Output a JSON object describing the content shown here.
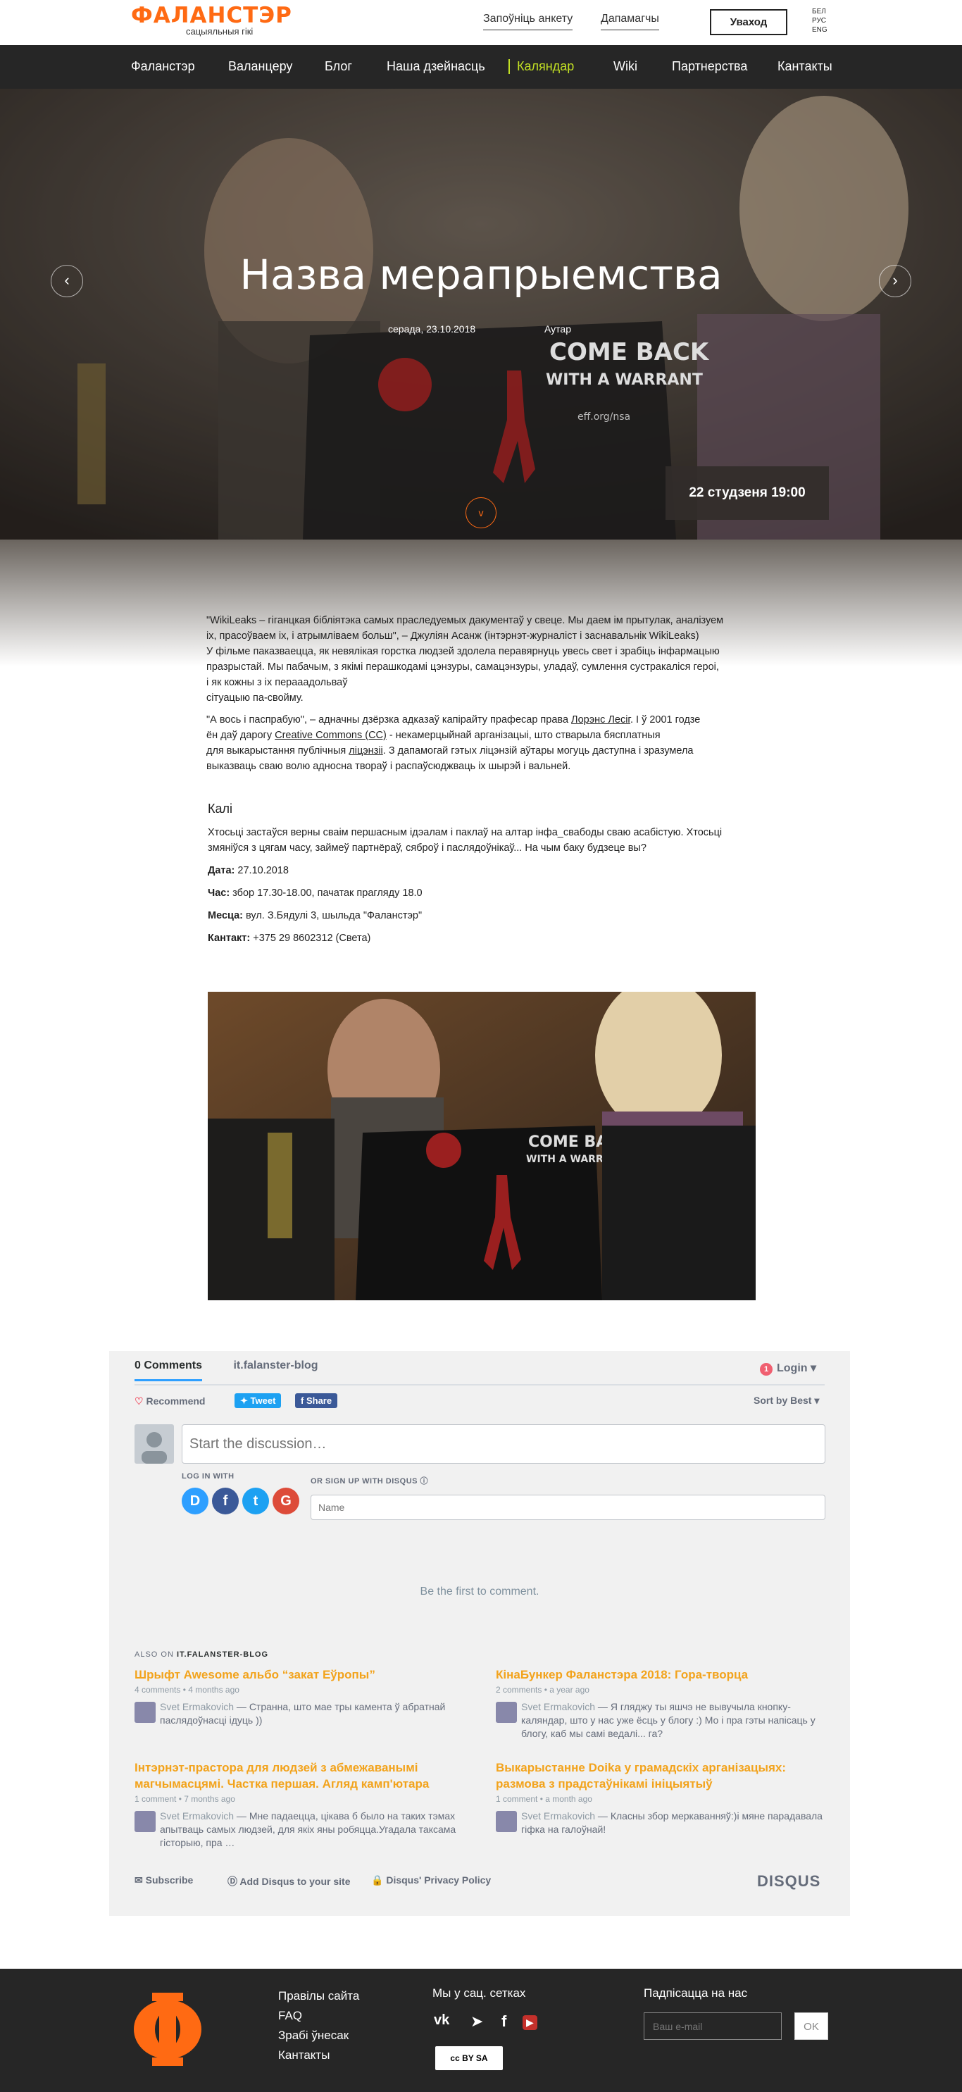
{
  "header": {
    "logo_text": "ФАЛАНСТЭР",
    "logo_tagline": "сацыяльныя гікі",
    "fill_form_link": "Запоўніць анкету",
    "help_link": "Дапамагчы",
    "login_button": "Уваход",
    "languages": [
      "БЕЛ",
      "РУС",
      "ENG"
    ]
  },
  "nav": {
    "items": [
      "Фаланстэр",
      "Валанцеру",
      "Блог",
      "Наша дзейнасць",
      "Каляндар",
      "Wiki",
      "Партнерства",
      "Кантакты"
    ],
    "active": "Каляндар",
    "active_color": "#c2e024"
  },
  "hero": {
    "title": "Назва мерапрыемства",
    "date": "серада, 23.10.2018",
    "author": "Аутар",
    "prev_icon": "‹",
    "next_icon": "›",
    "event_when": "22 студзеня 19:00",
    "scroll_icon": "v",
    "laptop_sticker_line1": "COME BACK",
    "laptop_sticker_line2": "WITH A WARRANT",
    "laptop_sticker_url": "eff.org/nsa"
  },
  "article": {
    "p1_line1": "\"WikiLeaks – гіганцкая бібліятэка самых праследуемых дакументаў у свеце. Мы даем ім прытулак, аналізуем",
    "p1_line2": "іх, прасоўваем іх, і атрымліваем больш\", – Джуліян Асанж (інтэрнэт-журналіст і заснавальнік WikiLeaks)",
    "p1_line3": "У фільме паказваецца, як невялікая горстка людзей здолела перавярнуць увесь свет і зрабіць інфармацыю",
    "p1_line4": "празрыстай. Мы пабачым, з якімі перашкодамі цэнзуры, самацэнзуры, уладаў, сумлення сустракаліся героі,",
    "p1_line5": "і як кожны з іх перааадольваў",
    "p1_line6": "сітуацыю па-свойму.",
    "p2_a": "\"А вось і паспрабую\", – адначны дзёрзка адказаў капірайту прафесар права ",
    "p2_link1": "Лорэнс Лесіг",
    "p2_b": ". І ў 2001 годзе",
    "p2_c": "ён даў дарогу ",
    "p2_link2": "Creative Commons (CC)",
    "p2_d": " - некамерцыйнай арганізацыі, што стварыла бясплатныя",
    "p2_e": "для выкарыстання публічныя ",
    "p2_link3": "ліцэнзіі",
    "p2_f": ". З дапамогай гэтых ліцэнзій аўтары могуць даступна і зразумела",
    "p2_g": "выказваць сваю волю адносна твораў і распаўсюджваць іх шырэй і вальней."
  },
  "event_info": {
    "heading": "Калі",
    "text_line1": "Хтосьці застаўся верны сваім першасным ідэалам і паклаў на алтар інфа_свабоды сваю асабістую. Хтосьці",
    "text_line2": "змяніўся з цягам часу, займеў партнёраў, сяброў і паслядоўнікаў... На чым баку будзеце вы?",
    "date_label": "Дата:",
    "date_value": " 27.10.2018",
    "time_label": "Час:",
    "time_value": " збор 17.30-18.00, пачатак прагляду 18.0",
    "place_label": "Месца:",
    "place_value": " вул. З.Бядулі 3, шыльда \"Фаланстэр\"",
    "contact_label": "Кантакт:",
    "contact_value": " +375 29 8602312  (Света)"
  },
  "disqus": {
    "tab_comments": "0 Comments",
    "tab_forum": "it.falanster-blog",
    "login": "Login",
    "login_badge": "1",
    "recommend": "Recommend",
    "tweet": "Tweet",
    "share": "Share",
    "sort": "Sort by Best",
    "placeholder": "Start the discussion…",
    "log_in_with": "LOG IN WITH",
    "or_sign_up": "OR SIGN UP WITH DISQUS",
    "name_placeholder": "Name",
    "first_comment": "Be the first to comment.",
    "also_on_prefix": "ALSO ON ",
    "also_on_site": "IT.FALANSTER-BLOG",
    "recommendations": [
      {
        "title": "Шрыфт Awesome альбо “закат Еўропы”",
        "meta": "4 comments • 4 months ago",
        "author": "Svet Ermakovich",
        "excerpt": " — Странна, што мае тры камента ў абратнай паслядоўнасці ідуць ))"
      },
      {
        "title": "КінаБункер Фаланстэра 2018: Гора-творца",
        "meta": "2 comments • a year ago",
        "author": "Svet Ermakovich",
        "excerpt": " — Я гляджу ты яшчэ не вывучыла кнопку-каляндар, што у нас уже ёсць у блогу :) Мо і пра гэты напісаць у блогу, каб мы самі ведалі... га?"
      },
      {
        "title": "Інтэрнэт-прастора для людзей з абмежаванымі магчымасцямі. Частка першая. Агляд камп'ютара",
        "meta": "1 comment • 7 months ago",
        "author": "Svet Ermakovich",
        "excerpt": " — Мне падаецца, цікава б было на таких тэмах апытваць самых людзей, для якіх яны робяцца.Угадала таксама гісторыю, пра …"
      },
      {
        "title": "Выкарыстанне Doika у грамадскіх арганізацыях: размова з прадстаўнікамі ініцыятыў",
        "meta": "1 comment • a month ago",
        "author": "Svet Ermakovich",
        "excerpt": " — Класны збор меркаванняў:)і мяне парадавала гіфка на галоўнай!"
      }
    ],
    "subscribe": "Subscribe",
    "add_disqus": "Add Disqus to your site",
    "privacy": "Disqus' Privacy Policy",
    "brand": "DISQUS",
    "colors": {
      "accent": "#2e9fff",
      "title": "#f2a31c"
    }
  },
  "footer": {
    "links": [
      "Правілы сайта",
      "FAQ",
      "Зрабі ўнесак",
      "Кантакты"
    ],
    "social_title": "Мы у сац. сетках",
    "social_icons": [
      "vk-icon",
      "telegram-icon",
      "facebook-icon",
      "youtube-icon"
    ],
    "cc_badge": "cc BY SA",
    "subscribe_title": "Падпісацца на нас",
    "email_placeholder": "Ваш e-mail",
    "ok_button": "OK",
    "logo_glyph": "Ф"
  },
  "colors": {
    "brand": "#ff6a13",
    "nav_bg": "#262626",
    "active": "#c2e024"
  }
}
